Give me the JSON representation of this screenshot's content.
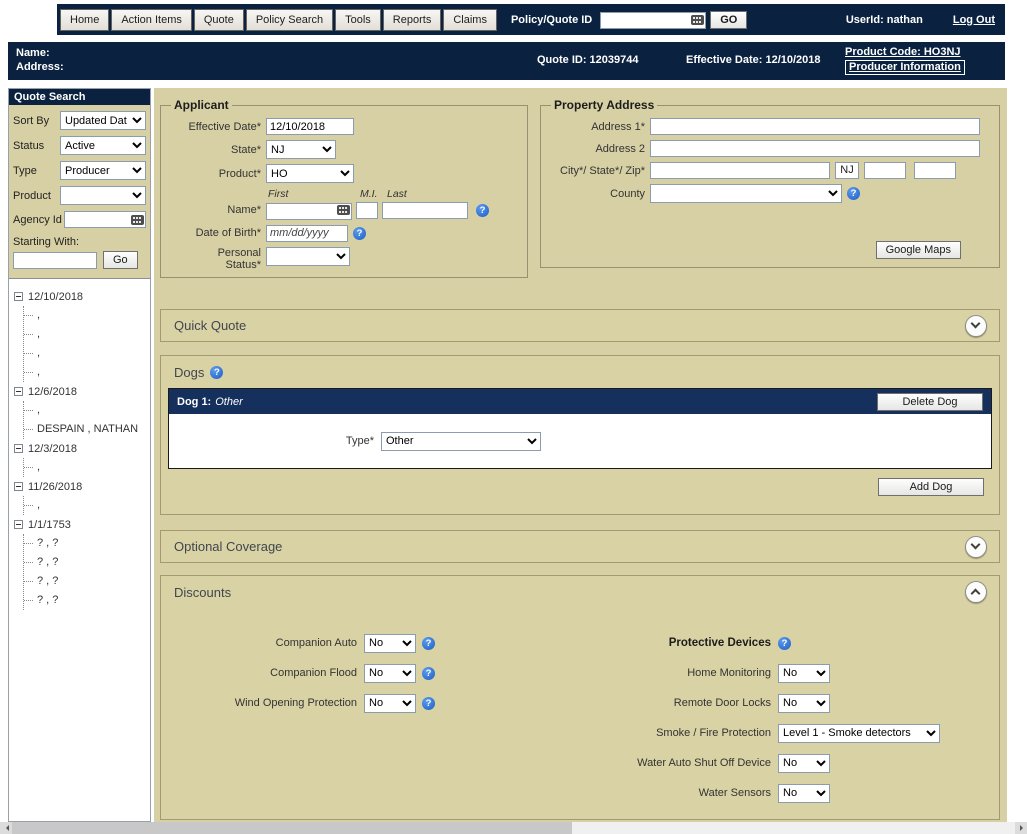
{
  "colors": {
    "navy": "#0a2240",
    "tan": "#d7d0a5",
    "panel_border": "#a29a70",
    "help_blue": "#1f66c4",
    "dog_bar": "#15305c"
  },
  "icons": {
    "help": "?"
  },
  "topnav": {
    "tabs": [
      "Home",
      "Action Items",
      "Quote",
      "Policy Search",
      "Tools",
      "Reports",
      "Claims"
    ],
    "policy_quote_label": "Policy/Quote ID",
    "go_button": "GO",
    "userid": "UserId: nathan",
    "logout": "Log Out"
  },
  "infobar": {
    "name_label": "Name:",
    "address_label": "Address:",
    "quote_id": "Quote ID: 12039744",
    "effective_date": "Effective Date: 12/10/2018",
    "product_code": "Product Code: HO3NJ",
    "producer_info": "Producer Information"
  },
  "sidebar": {
    "title": "Quote Search",
    "sort_by_label": "Sort By",
    "sort_by_value": "Updated Dat",
    "status_label": "Status",
    "status_value": "Active",
    "type_label": "Type",
    "type_value": "Producer",
    "product_label": "Product",
    "product_value": "",
    "agency_label": "Agency Id",
    "starting_with_label": "Starting With:",
    "go_button": "Go",
    "tree": [
      {
        "date": "12/10/2018",
        "children": [
          ",",
          ",",
          ",",
          ","
        ]
      },
      {
        "date": "12/6/2018",
        "children": [
          ",",
          "DESPAIN , NATHAN"
        ]
      },
      {
        "date": "12/3/2018",
        "children": [
          ","
        ]
      },
      {
        "date": "11/26/2018",
        "children": [
          ","
        ]
      },
      {
        "date": "1/1/1753",
        "children": [
          "? , ?",
          "? , ?",
          "? , ?",
          "? , ?"
        ]
      }
    ]
  },
  "applicant": {
    "legend": "Applicant",
    "effective_date_label": "Effective Date*",
    "effective_date_value": "12/10/2018",
    "state_label": "State*",
    "state_value": "NJ",
    "product_label": "Product*",
    "product_value": "HO",
    "first_header": "First",
    "mi_header": "M.I.",
    "last_header": "Last",
    "name_label": "Name*",
    "first_value": "",
    "mi_value": "",
    "last_value": "",
    "dob_label": "Date of Birth*",
    "dob_placeholder": "mm/dd/yyyy",
    "personal_status_label": "Personal Status*",
    "personal_status_value": ""
  },
  "property": {
    "legend": "Property Address",
    "address1_label": "Address 1*",
    "address1_value": "",
    "address2_label": "Address 2",
    "address2_value": "",
    "city_state_zip_label": "City*/ State*/ Zip*",
    "city_value": "",
    "state_value": "NJ",
    "zip_value": "",
    "zip4_value": "",
    "county_label": "County",
    "county_value": "",
    "google_maps_button": "Google Maps"
  },
  "sections": {
    "quick_quote": "Quick Quote",
    "dogs": "Dogs",
    "optional_coverage": "Optional Coverage",
    "discounts": "Discounts"
  },
  "dogs": {
    "header_prefix": "Dog 1:",
    "header_value": "Other",
    "delete_button": "Delete Dog",
    "type_label": "Type*",
    "type_value": "Other",
    "add_button": "Add Dog"
  },
  "discounts": {
    "companion_auto_label": "Companion Auto",
    "companion_auto_value": "No",
    "companion_flood_label": "Companion Flood",
    "companion_flood_value": "No",
    "wind_label": "Wind Opening Protection",
    "wind_value": "No",
    "protective_header": "Protective Devices",
    "home_monitoring_label": "Home Monitoring",
    "home_monitoring_value": "No",
    "remote_locks_label": "Remote Door Locks",
    "remote_locks_value": "No",
    "smoke_label": "Smoke / Fire Protection",
    "smoke_value": "Level 1 - Smoke detectors",
    "water_shutoff_label": "Water Auto Shut Off Device",
    "water_shutoff_value": "No",
    "water_sensors_label": "Water Sensors",
    "water_sensors_value": "No"
  }
}
